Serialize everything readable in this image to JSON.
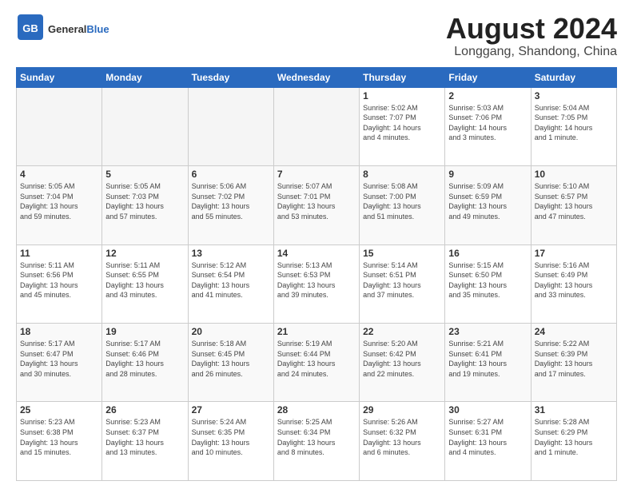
{
  "header": {
    "logo_general": "General",
    "logo_blue": "Blue",
    "month_title": "August 2024",
    "location": "Longgang, Shandong, China"
  },
  "weekdays": [
    "Sunday",
    "Monday",
    "Tuesday",
    "Wednesday",
    "Thursday",
    "Friday",
    "Saturday"
  ],
  "weeks": [
    [
      {
        "day": "",
        "info": ""
      },
      {
        "day": "",
        "info": ""
      },
      {
        "day": "",
        "info": ""
      },
      {
        "day": "",
        "info": ""
      },
      {
        "day": "1",
        "info": "Sunrise: 5:02 AM\nSunset: 7:07 PM\nDaylight: 14 hours\nand 4 minutes."
      },
      {
        "day": "2",
        "info": "Sunrise: 5:03 AM\nSunset: 7:06 PM\nDaylight: 14 hours\nand 3 minutes."
      },
      {
        "day": "3",
        "info": "Sunrise: 5:04 AM\nSunset: 7:05 PM\nDaylight: 14 hours\nand 1 minute."
      }
    ],
    [
      {
        "day": "4",
        "info": "Sunrise: 5:05 AM\nSunset: 7:04 PM\nDaylight: 13 hours\nand 59 minutes."
      },
      {
        "day": "5",
        "info": "Sunrise: 5:05 AM\nSunset: 7:03 PM\nDaylight: 13 hours\nand 57 minutes."
      },
      {
        "day": "6",
        "info": "Sunrise: 5:06 AM\nSunset: 7:02 PM\nDaylight: 13 hours\nand 55 minutes."
      },
      {
        "day": "7",
        "info": "Sunrise: 5:07 AM\nSunset: 7:01 PM\nDaylight: 13 hours\nand 53 minutes."
      },
      {
        "day": "8",
        "info": "Sunrise: 5:08 AM\nSunset: 7:00 PM\nDaylight: 13 hours\nand 51 minutes."
      },
      {
        "day": "9",
        "info": "Sunrise: 5:09 AM\nSunset: 6:59 PM\nDaylight: 13 hours\nand 49 minutes."
      },
      {
        "day": "10",
        "info": "Sunrise: 5:10 AM\nSunset: 6:57 PM\nDaylight: 13 hours\nand 47 minutes."
      }
    ],
    [
      {
        "day": "11",
        "info": "Sunrise: 5:11 AM\nSunset: 6:56 PM\nDaylight: 13 hours\nand 45 minutes."
      },
      {
        "day": "12",
        "info": "Sunrise: 5:11 AM\nSunset: 6:55 PM\nDaylight: 13 hours\nand 43 minutes."
      },
      {
        "day": "13",
        "info": "Sunrise: 5:12 AM\nSunset: 6:54 PM\nDaylight: 13 hours\nand 41 minutes."
      },
      {
        "day": "14",
        "info": "Sunrise: 5:13 AM\nSunset: 6:53 PM\nDaylight: 13 hours\nand 39 minutes."
      },
      {
        "day": "15",
        "info": "Sunrise: 5:14 AM\nSunset: 6:51 PM\nDaylight: 13 hours\nand 37 minutes."
      },
      {
        "day": "16",
        "info": "Sunrise: 5:15 AM\nSunset: 6:50 PM\nDaylight: 13 hours\nand 35 minutes."
      },
      {
        "day": "17",
        "info": "Sunrise: 5:16 AM\nSunset: 6:49 PM\nDaylight: 13 hours\nand 33 minutes."
      }
    ],
    [
      {
        "day": "18",
        "info": "Sunrise: 5:17 AM\nSunset: 6:47 PM\nDaylight: 13 hours\nand 30 minutes."
      },
      {
        "day": "19",
        "info": "Sunrise: 5:17 AM\nSunset: 6:46 PM\nDaylight: 13 hours\nand 28 minutes."
      },
      {
        "day": "20",
        "info": "Sunrise: 5:18 AM\nSunset: 6:45 PM\nDaylight: 13 hours\nand 26 minutes."
      },
      {
        "day": "21",
        "info": "Sunrise: 5:19 AM\nSunset: 6:44 PM\nDaylight: 13 hours\nand 24 minutes."
      },
      {
        "day": "22",
        "info": "Sunrise: 5:20 AM\nSunset: 6:42 PM\nDaylight: 13 hours\nand 22 minutes."
      },
      {
        "day": "23",
        "info": "Sunrise: 5:21 AM\nSunset: 6:41 PM\nDaylight: 13 hours\nand 19 minutes."
      },
      {
        "day": "24",
        "info": "Sunrise: 5:22 AM\nSunset: 6:39 PM\nDaylight: 13 hours\nand 17 minutes."
      }
    ],
    [
      {
        "day": "25",
        "info": "Sunrise: 5:23 AM\nSunset: 6:38 PM\nDaylight: 13 hours\nand 15 minutes."
      },
      {
        "day": "26",
        "info": "Sunrise: 5:23 AM\nSunset: 6:37 PM\nDaylight: 13 hours\nand 13 minutes."
      },
      {
        "day": "27",
        "info": "Sunrise: 5:24 AM\nSunset: 6:35 PM\nDaylight: 13 hours\nand 10 minutes."
      },
      {
        "day": "28",
        "info": "Sunrise: 5:25 AM\nSunset: 6:34 PM\nDaylight: 13 hours\nand 8 minutes."
      },
      {
        "day": "29",
        "info": "Sunrise: 5:26 AM\nSunset: 6:32 PM\nDaylight: 13 hours\nand 6 minutes."
      },
      {
        "day": "30",
        "info": "Sunrise: 5:27 AM\nSunset: 6:31 PM\nDaylight: 13 hours\nand 4 minutes."
      },
      {
        "day": "31",
        "info": "Sunrise: 5:28 AM\nSunset: 6:29 PM\nDaylight: 13 hours\nand 1 minute."
      }
    ]
  ]
}
